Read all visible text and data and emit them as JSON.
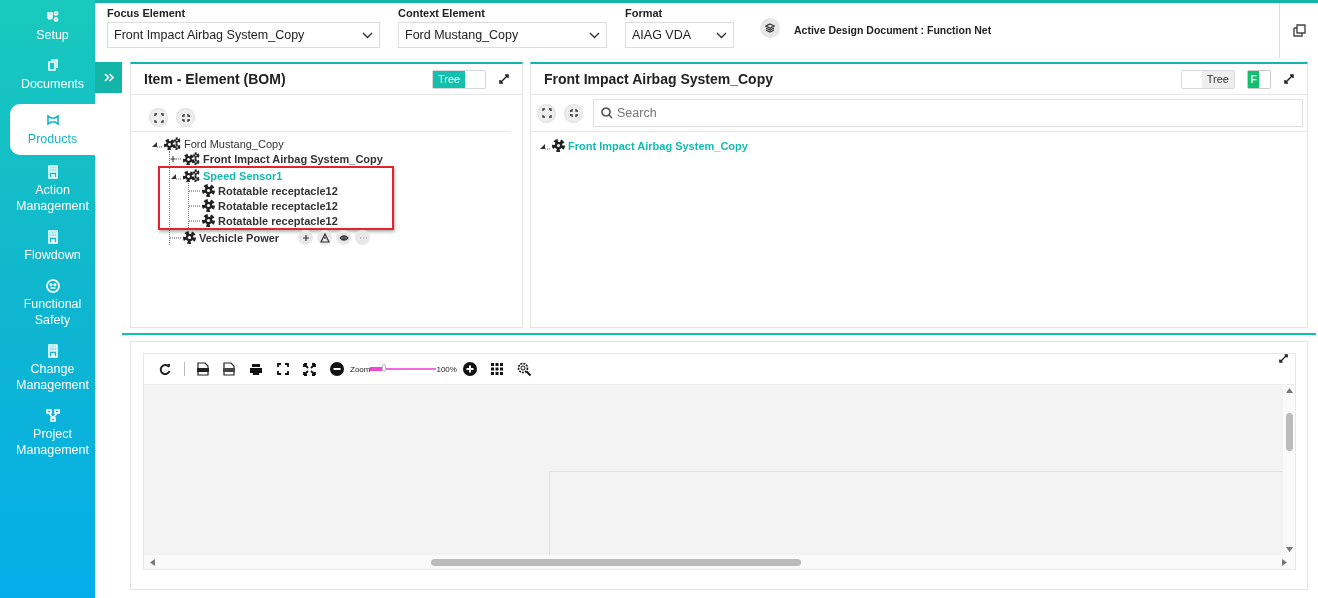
{
  "sidebar": {
    "items": [
      {
        "label": "Setup",
        "selected": false
      },
      {
        "label": "Documents",
        "selected": false
      },
      {
        "label": "Products",
        "selected": true
      },
      {
        "label": "Action Management",
        "selected": false
      },
      {
        "label": "Flowdown",
        "selected": false
      },
      {
        "label": "Functional Safety",
        "selected": false
      },
      {
        "label": "Change Management",
        "selected": false
      },
      {
        "label": "Project Management",
        "selected": false
      }
    ]
  },
  "header": {
    "fields": [
      {
        "label": "Focus Element",
        "value": "Front Impact Airbag System_Copy"
      },
      {
        "label": "Context Element",
        "value": "Ford Mustang_Copy"
      },
      {
        "label": "Format",
        "value": "AIAG VDA"
      }
    ],
    "active_document": "Active Design Document : Function Net"
  },
  "left_panel": {
    "title": "Item - Element (BOM)",
    "tree_toggle": {
      "label": "Tree",
      "on": true
    },
    "tree": [
      {
        "label": "Ford Mustang_Copy",
        "kind": "assembly",
        "expanded": true,
        "selected": false,
        "highlighted": false,
        "hovered": false,
        "children": [
          {
            "label": "Front Impact Airbag System_Copy",
            "kind": "assembly",
            "expanded": false,
            "selected": false,
            "highlighted": false,
            "hovered": false
          },
          {
            "label": "Speed Sensor1",
            "kind": "assembly",
            "expanded": true,
            "selected": true,
            "highlighted": true,
            "hovered": false,
            "children": [
              {
                "label": "Rotatable receptacle12",
                "kind": "part",
                "selected": false,
                "highlighted": false,
                "hovered": false
              },
              {
                "label": "Rotatable receptacle12",
                "kind": "part",
                "selected": false,
                "highlighted": false,
                "hovered": false
              },
              {
                "label": "Rotatable receptacle12",
                "kind": "part",
                "selected": false,
                "highlighted": false,
                "hovered": false
              }
            ]
          },
          {
            "label": "Vechicle Power",
            "kind": "part",
            "selected": false,
            "highlighted": false,
            "hovered": true
          }
        ]
      }
    ]
  },
  "right_panel": {
    "title": "Front Impact Airbag System_Copy",
    "tree_toggle": {
      "label": "Tree",
      "on": false
    },
    "f_toggle": {
      "label": "F",
      "on": true
    },
    "search": {
      "placeholder": "Search"
    },
    "tree": [
      {
        "label": "Front Impact Airbag System_Copy",
        "kind": "part",
        "expanded": true,
        "selected": true,
        "highlighted": false,
        "hovered": false
      }
    ]
  },
  "diagram": {
    "zoom": {
      "label": "Zoom",
      "reading": "100%",
      "level": 0.2
    }
  }
}
